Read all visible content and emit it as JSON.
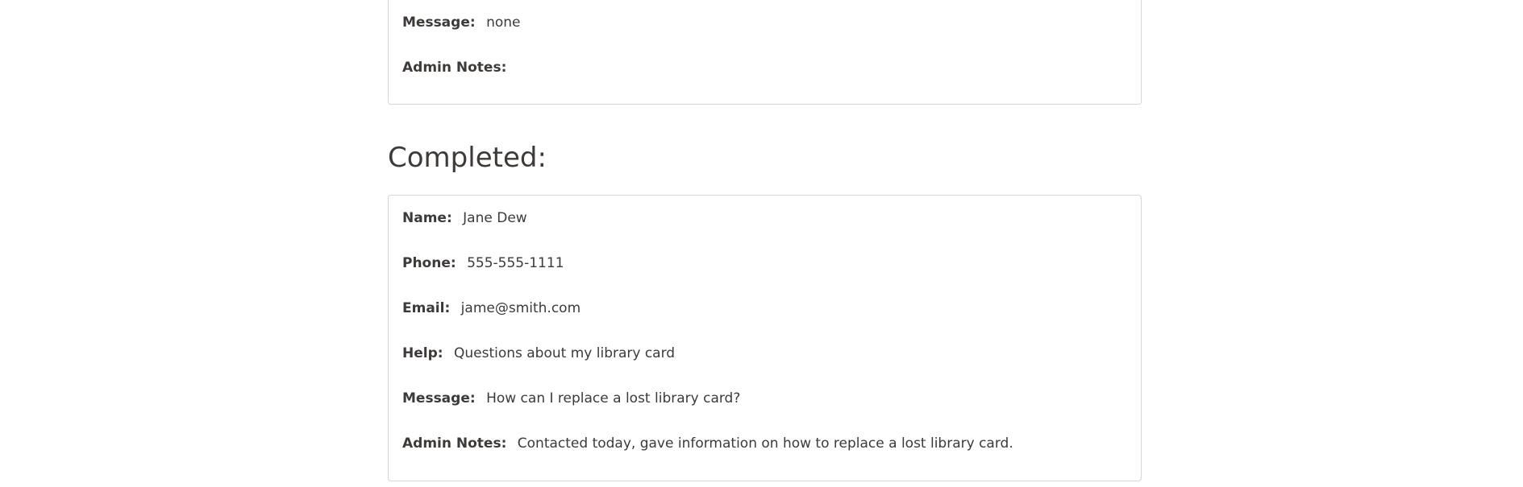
{
  "previous_entry": {
    "fields": [
      {
        "label": "Message:",
        "value": "none"
      },
      {
        "label": "Admin Notes:",
        "value": ""
      }
    ]
  },
  "completed_section": {
    "title": "Completed:",
    "entry": {
      "fields": [
        {
          "label": "Name:",
          "value": "Jane Dew"
        },
        {
          "label": "Phone:",
          "value": "555-555-1111"
        },
        {
          "label": "Email:",
          "value": "jame@smith.com"
        },
        {
          "label": "Help:",
          "value": "Questions about my library card"
        },
        {
          "label": "Message:",
          "value": "How can I replace a lost library card?"
        },
        {
          "label": "Admin Notes:",
          "value": "Contacted today, gave information on how to replace a lost library card."
        }
      ]
    }
  }
}
